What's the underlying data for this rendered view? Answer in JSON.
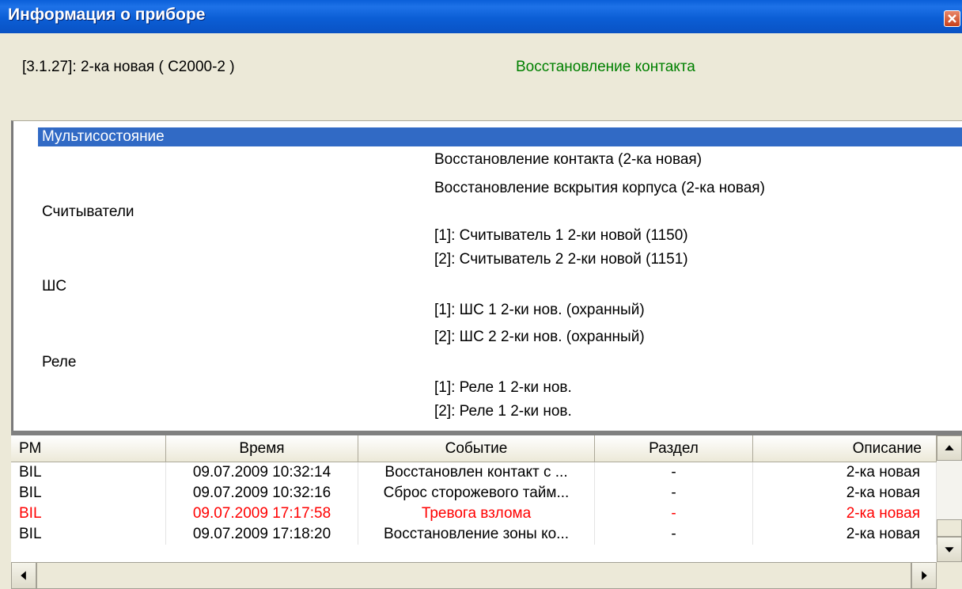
{
  "window": {
    "title": "Информация о приборе",
    "close_icon": "close-icon"
  },
  "info": {
    "device": "[3.1.27]: 2-ка новая ( С2000-2 )",
    "status": "Восстановление контакта",
    "status_color": "#008000"
  },
  "tree": {
    "selected": "Мультисостояние",
    "multistate_items": [
      "Восстановление контакта (2-ка новая)",
      "Восстановление вскрытия корпуса (2-ка новая)"
    ],
    "groups": [
      {
        "label": "Считыватели",
        "items": [
          "[1]: Считыватель 1 2-ки новой (1150)",
          "[2]: Считыватель 2 2-ки новой (1151)"
        ]
      },
      {
        "label": "ШС",
        "items": [
          "[1]: ШС 1 2-ки нов. (охранный)",
          "[2]: ШС 2 2-ки нов. (охранный)"
        ]
      },
      {
        "label": "Реле",
        "items": [
          "[1]: Реле 1 2-ки нов.",
          "[2]: Реле 1 2-ки нов."
        ]
      }
    ]
  },
  "events": {
    "columns": [
      "РМ",
      "Время",
      "Событие",
      "Раздел",
      "Описание"
    ],
    "rows": [
      {
        "rm": "BIL",
        "time": "09.07.2009 10:32:14",
        "event": "Восстановлен контакт с ...",
        "section": "-",
        "desc": "2-ка новая",
        "alarm": false
      },
      {
        "rm": "BIL",
        "time": "09.07.2009 10:32:16",
        "event": "Сброс сторожевого тайм...",
        "section": "-",
        "desc": "2-ка новая",
        "alarm": false
      },
      {
        "rm": "BIL",
        "time": "09.07.2009 17:17:58",
        "event": "Тревога взлома",
        "section": "-",
        "desc": "2-ка новая",
        "alarm": true
      },
      {
        "rm": "BIL",
        "time": "09.07.2009 17:18:20",
        "event": "Восстановление зоны ко...",
        "section": "-",
        "desc": "2-ка новая",
        "alarm": false
      }
    ],
    "alarm_color": "#FF0000"
  },
  "colors": {
    "titlebar": "#0A5FD8",
    "selection": "#316AC5",
    "face": "#ECE9D8"
  }
}
